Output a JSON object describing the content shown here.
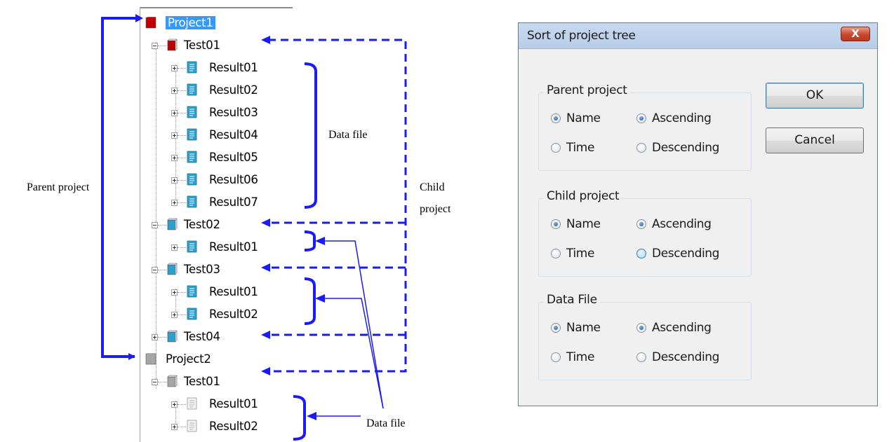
{
  "tree": {
    "nodes": [
      {
        "label": "Project1",
        "type": "parent-red"
      },
      {
        "label": "Test01",
        "type": "child-red"
      },
      {
        "label": "Result01",
        "type": "file"
      },
      {
        "label": "Result02",
        "type": "file"
      },
      {
        "label": "Result03",
        "type": "file"
      },
      {
        "label": "Result04",
        "type": "file"
      },
      {
        "label": "Result05",
        "type": "file"
      },
      {
        "label": "Result06",
        "type": "file"
      },
      {
        "label": "Result07",
        "type": "file"
      },
      {
        "label": "Test02",
        "type": "child-blue"
      },
      {
        "label": "Result01",
        "type": "file"
      },
      {
        "label": "Test03",
        "type": "child-blue"
      },
      {
        "label": "Result01",
        "type": "file"
      },
      {
        "label": "Result02",
        "type": "file"
      },
      {
        "label": "Test04",
        "type": "child-blue"
      },
      {
        "label": "Project2",
        "type": "parent-gray"
      },
      {
        "label": "Test01",
        "type": "child-gray"
      },
      {
        "label": "Result01",
        "type": "file-gray"
      },
      {
        "label": "Result02",
        "type": "file-gray"
      }
    ]
  },
  "annotations": {
    "parent_project": "Parent project",
    "child_project_line1": "Child",
    "child_project_line2": "project",
    "data_file_top": "Data file",
    "data_file_bottom": "Data file"
  },
  "dialog": {
    "title": "Sort of project tree",
    "close_label": "X",
    "ok_label": "OK",
    "cancel_label": "Cancel",
    "groups": [
      {
        "title": "Parent project",
        "name": "Name",
        "time": "Time",
        "ascending": "Ascending",
        "descending": "Descending",
        "key": "name",
        "order": "ascending"
      },
      {
        "title": "Child project",
        "name": "Name",
        "time": "Time",
        "ascending": "Ascending",
        "descending": "Descending",
        "key": "name",
        "order": "ascending"
      },
      {
        "title": "Data File",
        "name": "Name",
        "time": "Time",
        "ascending": "Ascending",
        "descending": "Descending",
        "key": "name",
        "order": "ascending"
      }
    ]
  },
  "colors": {
    "annotation_blue": "#1a1aff",
    "selection": "#3399ff",
    "red_icon": "#c00000",
    "blue_icon": "#2a9fd0",
    "gray_icon": "#a6a6a6"
  }
}
